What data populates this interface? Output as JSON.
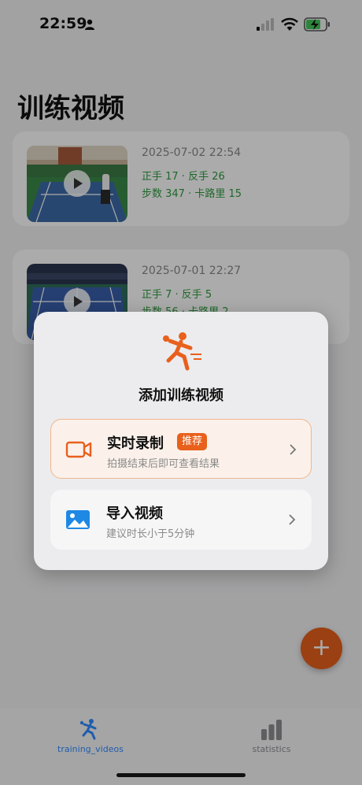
{
  "status_bar": {
    "time": "22:59"
  },
  "page": {
    "title": "训练视频"
  },
  "videos": [
    {
      "date": "2025-07-02 22:54",
      "stats_line1": "正手 17 · 反手 26",
      "stats_line2": "步数 347 · 卡路里 15"
    },
    {
      "date": "2025-07-01 22:27",
      "stats_line1": "正手 7 · 反手 5",
      "stats_line2": "步数 56 · 卡路里 2"
    }
  ],
  "sheet": {
    "title": "添加训练视频",
    "options": [
      {
        "title": "实时录制",
        "badge": "推荐",
        "subtitle": "拍摄结束后即可查看结果",
        "icon": "video-camera-icon"
      },
      {
        "title": "导入视频",
        "subtitle": "建议时长小于5分钟",
        "icon": "image-icon"
      }
    ]
  },
  "fab": {
    "label": "+"
  },
  "tabs": [
    {
      "label": "training_videos",
      "active": true,
      "icon": "tennis-player-icon"
    },
    {
      "label": "statistics",
      "active": false,
      "icon": "bar-chart-icon"
    }
  ],
  "colors": {
    "accent": "#e8601c",
    "tab_active": "#2f8bff",
    "stat_green": "#2e9b3c"
  }
}
